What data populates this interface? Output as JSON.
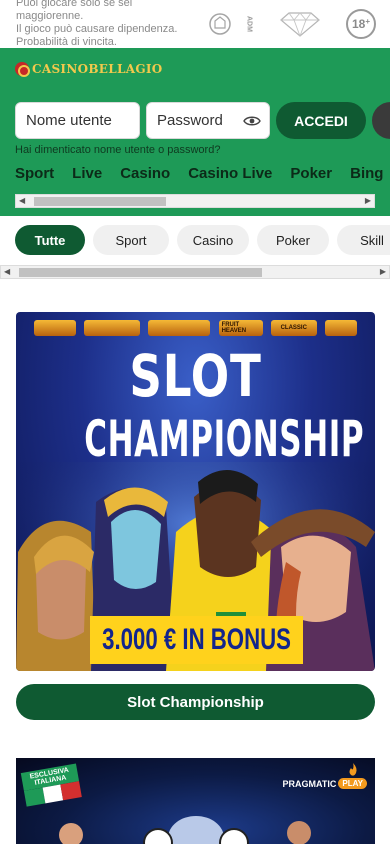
{
  "disclaimer": {
    "lines": [
      "Puoi giocare solo se sei",
      "maggiorenne.",
      "Il gioco può causare dipendenza.",
      "Probabilità di vincita."
    ]
  },
  "regulators": {
    "adm_label": "ADM",
    "age_label": "18",
    "age_plus": "+"
  },
  "header": {
    "brand": "CASINOBELLAGIO",
    "username_placeholder": "Nome utente",
    "password_placeholder": "Password",
    "login_label": "ACCEDI",
    "forgot_link": "Hai dimenticato nome utente o password?",
    "nav": [
      "Sport",
      "Live",
      "Casino",
      "Casino Live",
      "Poker",
      "Bing"
    ]
  },
  "filters": {
    "chips": [
      "Tutte",
      "Sport",
      "Casino",
      "Poker",
      "Skill"
    ],
    "active_index": 0
  },
  "promo": {
    "partners": [
      "",
      "",
      "",
      "FRUIT HEAVEN",
      "CLASSIC",
      ""
    ],
    "title_line1": "SLOT",
    "title_line2": "CHAMPIONSHIP",
    "bonus": "3.000 € IN BONUS",
    "cta_label": "Slot Championship"
  },
  "promo2": {
    "badge_line1": "ESCLUSIVA",
    "badge_line2": "ITALIANA",
    "provider": "PRAGMATIC",
    "provider_play": "PLAY"
  },
  "colors": {
    "brand_green": "#1e9a57",
    "dark_green": "#0f5a32",
    "gold": "#f2c94c",
    "bonus_yellow": "#ffd21c"
  }
}
